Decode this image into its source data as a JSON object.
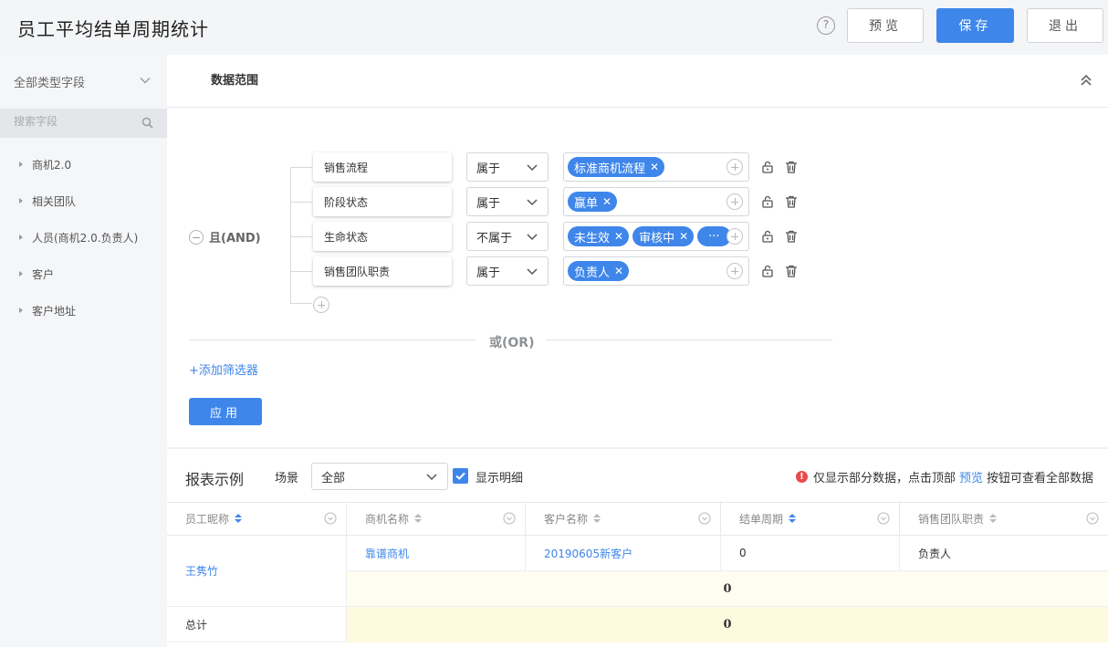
{
  "header": {
    "title": "员工平均结单周期统计",
    "help_icon": "?",
    "preview_label": "预览",
    "save_label": "保存",
    "exit_label": "退出"
  },
  "sidebar": {
    "field_type_label": "全部类型字段",
    "search_placeholder": "搜索字段",
    "items": [
      {
        "label": "商机2.0"
      },
      {
        "label": "相关团队"
      },
      {
        "label": "人员(商机2.0.负责人)"
      },
      {
        "label": "客户"
      },
      {
        "label": "客户地址"
      }
    ]
  },
  "filter": {
    "section_title": "数据范围",
    "and_label": "且(AND)",
    "or_label": "或(OR)",
    "add_filter_label": "+添加筛选器",
    "apply_label": "应用",
    "rows": [
      {
        "field": "销售流程",
        "operator": "属于",
        "values": [
          "标准商机流程"
        ]
      },
      {
        "field": "阶段状态",
        "operator": "属于",
        "values": [
          "赢单"
        ]
      },
      {
        "field": "生命状态",
        "operator": "不属于",
        "values": [
          "未生效",
          "审核中"
        ],
        "more": "···"
      },
      {
        "field": "销售团队职责",
        "operator": "属于",
        "values": [
          "负责人"
        ]
      }
    ]
  },
  "report": {
    "title": "报表示例",
    "scene_label": "场景",
    "scene_value": "全部",
    "show_detail_label": "显示明细",
    "show_detail_checked": true,
    "notice_before": "仅显示部分数据，点击顶部",
    "notice_link": "预览",
    "notice_after": "按钮可查看全部数据",
    "columns": [
      "员工昵称",
      "商机名称",
      "客户名称",
      "结单周期",
      "销售团队职责"
    ],
    "rows": [
      {
        "employee": "王隽竹",
        "opportunity": "靠谱商机",
        "customer": "20190605新客户",
        "cycle": "0",
        "role": "负责人"
      }
    ],
    "subtotal_value": "0",
    "total_label": "总计",
    "total_value": "0"
  },
  "colors": {
    "accent": "#3f86ea",
    "warning": "#e94b4b",
    "header_bg": "#f4f5f7",
    "sidebar_bg": "#f5f6f8"
  }
}
